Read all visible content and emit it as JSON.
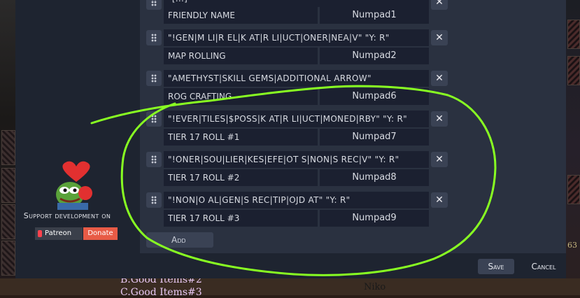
{
  "background": {
    "item_1": "B.Good Items#2",
    "item_2": "C.Good Items#3",
    "niko": "Niko",
    "side_number": "63"
  },
  "rows": [
    {
      "name": "\"[...]\"",
      "label": "FRIENDLY NAME",
      "key": "Numpad1"
    },
    {
      "name": "\"!GEN|M LI|R EL|K AT|R LI|UCT|ONER|NEA|V\" \"Y: R\"",
      "label": "MAP ROLLING",
      "key": "Numpad2"
    },
    {
      "name": "\"AMETHYST|SKILL GEMS|ADDITIONAL ARROW\"",
      "label": "ROG CRAFTING",
      "key": "Numpad6"
    },
    {
      "name": "\"!EVER|TILES|$POSS|K AT|R LI|UCT|MONED|RBY\" \"Y: R\"",
      "label": "TIER 17 ROLL #1",
      "key": "Numpad7"
    },
    {
      "name": "\"!ONER|SOU|LIER|KES|EFE|OT S|NON|S REC|V\" \"Y: R\"",
      "label": "TIER 17 ROLL #2",
      "key": "Numpad8"
    },
    {
      "name": "\"!NON|O AL|GEN|S REC|TIP|OJD AT\" \"Y: R\"",
      "label": "TIER 17 ROLL #3",
      "key": "Numpad9"
    }
  ],
  "buttons": {
    "add": "Add",
    "save": "Save",
    "cancel": "Cancel",
    "close_glyph": "✕"
  },
  "support": {
    "text": "Support development on",
    "patreon": "Patreon",
    "donate": "Donate"
  },
  "colors": {
    "annotation": "#88ff22",
    "heart": "#e23030",
    "patreon_red": "#ff424d",
    "donate_orange": "#e85b46"
  }
}
